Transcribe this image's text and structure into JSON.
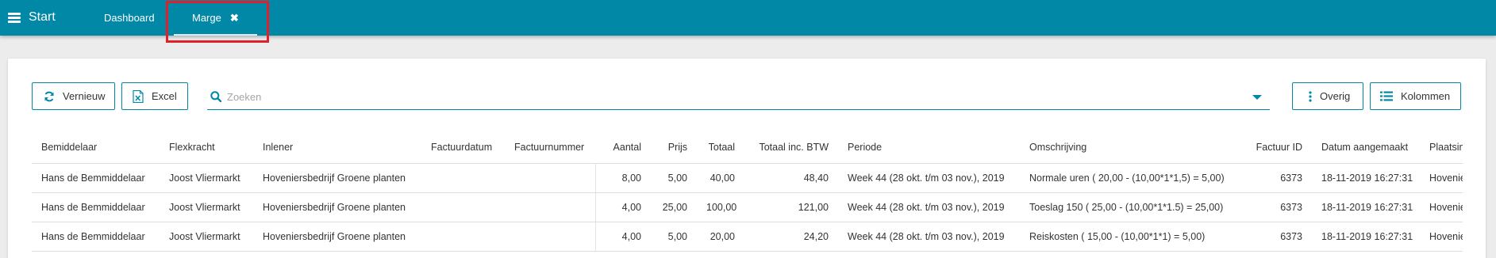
{
  "topbar": {
    "start_label": "Start",
    "tabs": [
      {
        "label": "Dashboard"
      },
      {
        "label": "Marge",
        "close": "✖"
      }
    ]
  },
  "toolbar": {
    "refresh_label": "Vernieuw",
    "excel_label": "Excel",
    "search_placeholder": "Zoeken",
    "overig_label": "Overig",
    "kolommen_label": "Kolommen"
  },
  "table": {
    "columns": [
      "Bemiddelaar",
      "Flexkracht",
      "Inlener",
      "Factuurdatum",
      "Factuurnummer",
      "Aantal",
      "Prijs",
      "Totaal",
      "Totaal inc. BTW",
      "Periode",
      "Omschrijving",
      "Factuur ID",
      "Datum aangemaakt",
      "Plaatsing"
    ],
    "rows": [
      [
        "Hans de Bemmiddelaar",
        "Joost Vliermarkt",
        "Hoveniersbedrijf Groene planten",
        "",
        "",
        "8,00",
        "5,00",
        "40,00",
        "48,40",
        "Week 44 (28 okt. t/m 03 nov.), 2019",
        "Normale uren ( 20,00 - (10,00*1*1,5) = 5,00)",
        "6373",
        "18-11-2019 16:27:31",
        "Hoveniersbedrijf"
      ],
      [
        "Hans de Bemmiddelaar",
        "Joost Vliermarkt",
        "Hoveniersbedrijf Groene planten",
        "",
        "",
        "4,00",
        "25,00",
        "100,00",
        "121,00",
        "Week 44 (28 okt. t/m 03 nov.), 2019",
        "Toeslag 150 ( 25,00 - (10,00*1*1.5) = 25,00)",
        "6373",
        "18-11-2019 16:27:31",
        "Hoveniersbedrijf"
      ],
      [
        "Hans de Bemmiddelaar",
        "Joost Vliermarkt",
        "Hoveniersbedrijf Groene planten",
        "",
        "",
        "4,00",
        "5,00",
        "20,00",
        "24,20",
        "Week 44 (28 okt. t/m 03 nov.), 2019",
        "Reiskosten ( 15,00 - (10,00*1*1) = 5,00)",
        "6373",
        "18-11-2019 16:27:31",
        "Hoveniersbedrijf"
      ]
    ]
  },
  "colors": {
    "accent": "#0088a6",
    "highlight": "#e0212b"
  }
}
